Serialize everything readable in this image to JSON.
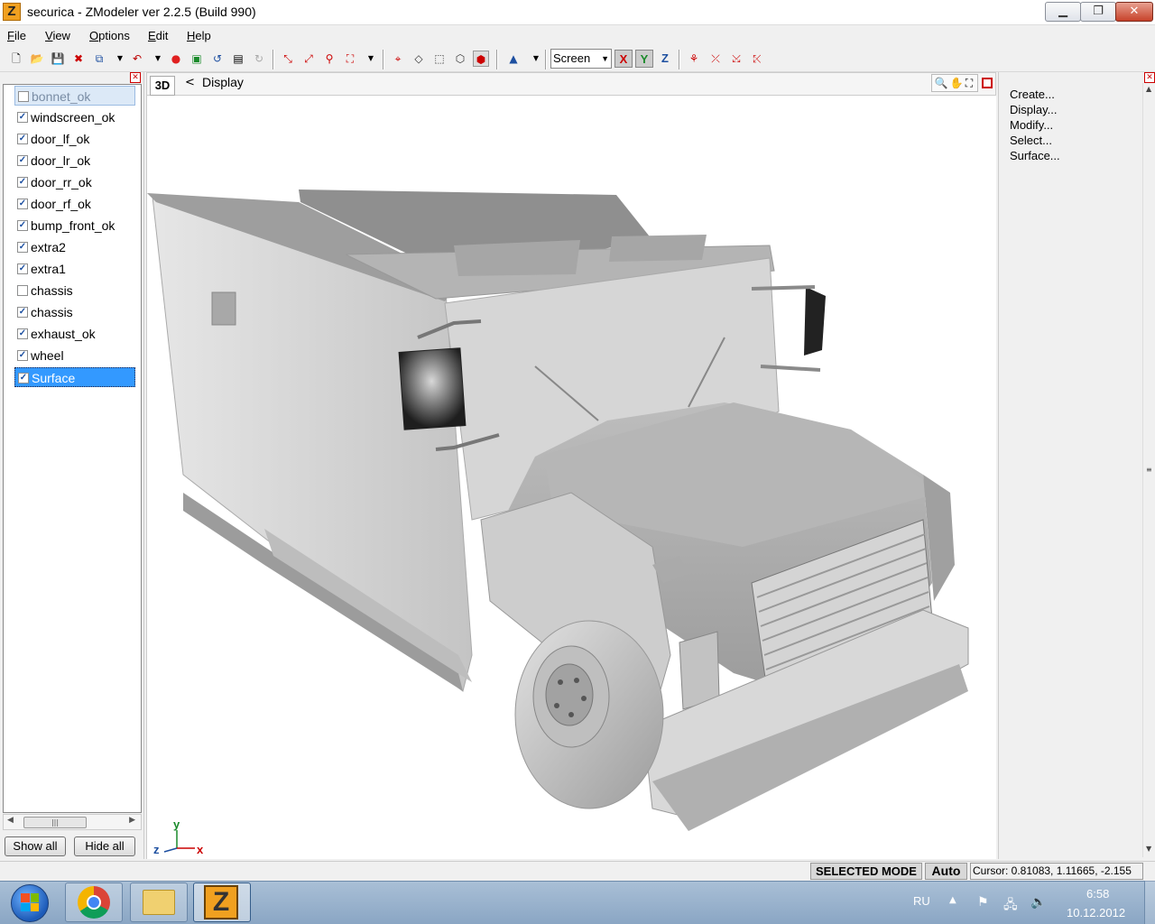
{
  "window": {
    "title": "securica - ZModeler ver 2.2.5 (Build 990)",
    "icon_letter": "Z",
    "minimize_label": "▁",
    "maximize_label": "❐",
    "close_label": "✕"
  },
  "menu": [
    {
      "underline": "F",
      "rest": "ile"
    },
    {
      "underline": "V",
      "rest": "iew"
    },
    {
      "underline": "O",
      "rest": "ptions"
    },
    {
      "underline": "E",
      "rest": "dit"
    },
    {
      "underline": "H",
      "rest": "elp"
    }
  ],
  "toolbar": {
    "view_combo": "Screen",
    "axis_x": "X",
    "axis_y": "Y",
    "axis_z": "Z"
  },
  "objects": {
    "items": [
      {
        "label": "bonnet_ok",
        "checked": false,
        "state": "light"
      },
      {
        "label": "windscreen_ok",
        "checked": true,
        "state": ""
      },
      {
        "label": "door_lf_ok",
        "checked": true,
        "state": ""
      },
      {
        "label": "door_lr_ok",
        "checked": true,
        "state": ""
      },
      {
        "label": "door_rr_ok",
        "checked": true,
        "state": ""
      },
      {
        "label": "door_rf_ok",
        "checked": true,
        "state": ""
      },
      {
        "label": "bump_front_ok",
        "checked": true,
        "state": ""
      },
      {
        "label": "extra2",
        "checked": true,
        "state": ""
      },
      {
        "label": "extra1",
        "checked": true,
        "state": ""
      },
      {
        "label": "chassis",
        "checked": false,
        "state": ""
      },
      {
        "label": "chassis",
        "checked": true,
        "state": ""
      },
      {
        "label": "exhaust_ok",
        "checked": true,
        "state": ""
      },
      {
        "label": "wheel",
        "checked": true,
        "state": ""
      },
      {
        "label": "Surface",
        "checked": true,
        "state": "dark"
      }
    ],
    "show_all": "Show all",
    "hide_all": "Hide all"
  },
  "viewport": {
    "mode_tag": "3D",
    "back_arrow": "<",
    "label": "Display",
    "tools_glyphs": "🔍✋⛶",
    "gizmo": {
      "x": "x",
      "y": "y",
      "z": "z"
    }
  },
  "command_panel": {
    "items": [
      "Create...",
      "Display...",
      "Modify...",
      "Select...",
      "Surface..."
    ]
  },
  "status": {
    "mode": "SELECTED MODE",
    "auto": "Auto",
    "cursor": "Cursor: 0.81083, 1.11665, -2.155"
  },
  "taskbar": {
    "lang": "RU",
    "time": "6:58",
    "date": "10.12.2012",
    "app_icon_letter": "Z"
  },
  "colors": {
    "accent_selection": "#3399ff",
    "model_gray": "#c8c8c8",
    "viewport_bg": "#ffffff"
  }
}
